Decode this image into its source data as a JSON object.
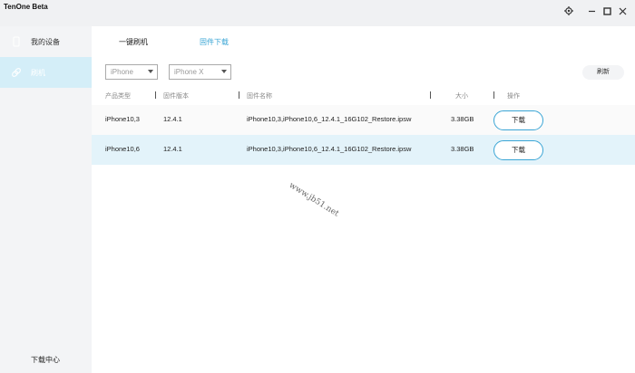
{
  "app": {
    "title": "TenOne Beta"
  },
  "sidebar": {
    "items": [
      {
        "label": "我的设备",
        "icon": "phone-icon"
      },
      {
        "label": "刷机",
        "icon": "link-icon"
      }
    ],
    "bottom_label": "下载中心"
  },
  "tabs": [
    {
      "label": "一键刷机"
    },
    {
      "label": "固件下载"
    }
  ],
  "filters": {
    "device_type": "iPhone",
    "model": "iPhone X"
  },
  "refresh_label": "刷新",
  "table": {
    "headers": [
      "产品类型",
      "固件版本",
      "固件名称",
      "大小",
      "操作"
    ],
    "rows": [
      {
        "product": "iPhone10,3",
        "version": "12.4.1",
        "name": "iPhone10,3,iPhone10,6_12.4.1_16G102_Restore.ipsw",
        "size": "3.38GB",
        "action": "下载"
      },
      {
        "product": "iPhone10,6",
        "version": "12.4.1",
        "name": "iPhone10,3,iPhone10,6_12.4.1_16G102_Restore.ipsw",
        "size": "3.38GB",
        "action": "下载"
      }
    ]
  },
  "watermark": "www.jb51.net",
  "colors": {
    "accent": "#3aa5d5",
    "selected_row": "#e3f3fa",
    "sidebar_active": "#d4eef8"
  }
}
